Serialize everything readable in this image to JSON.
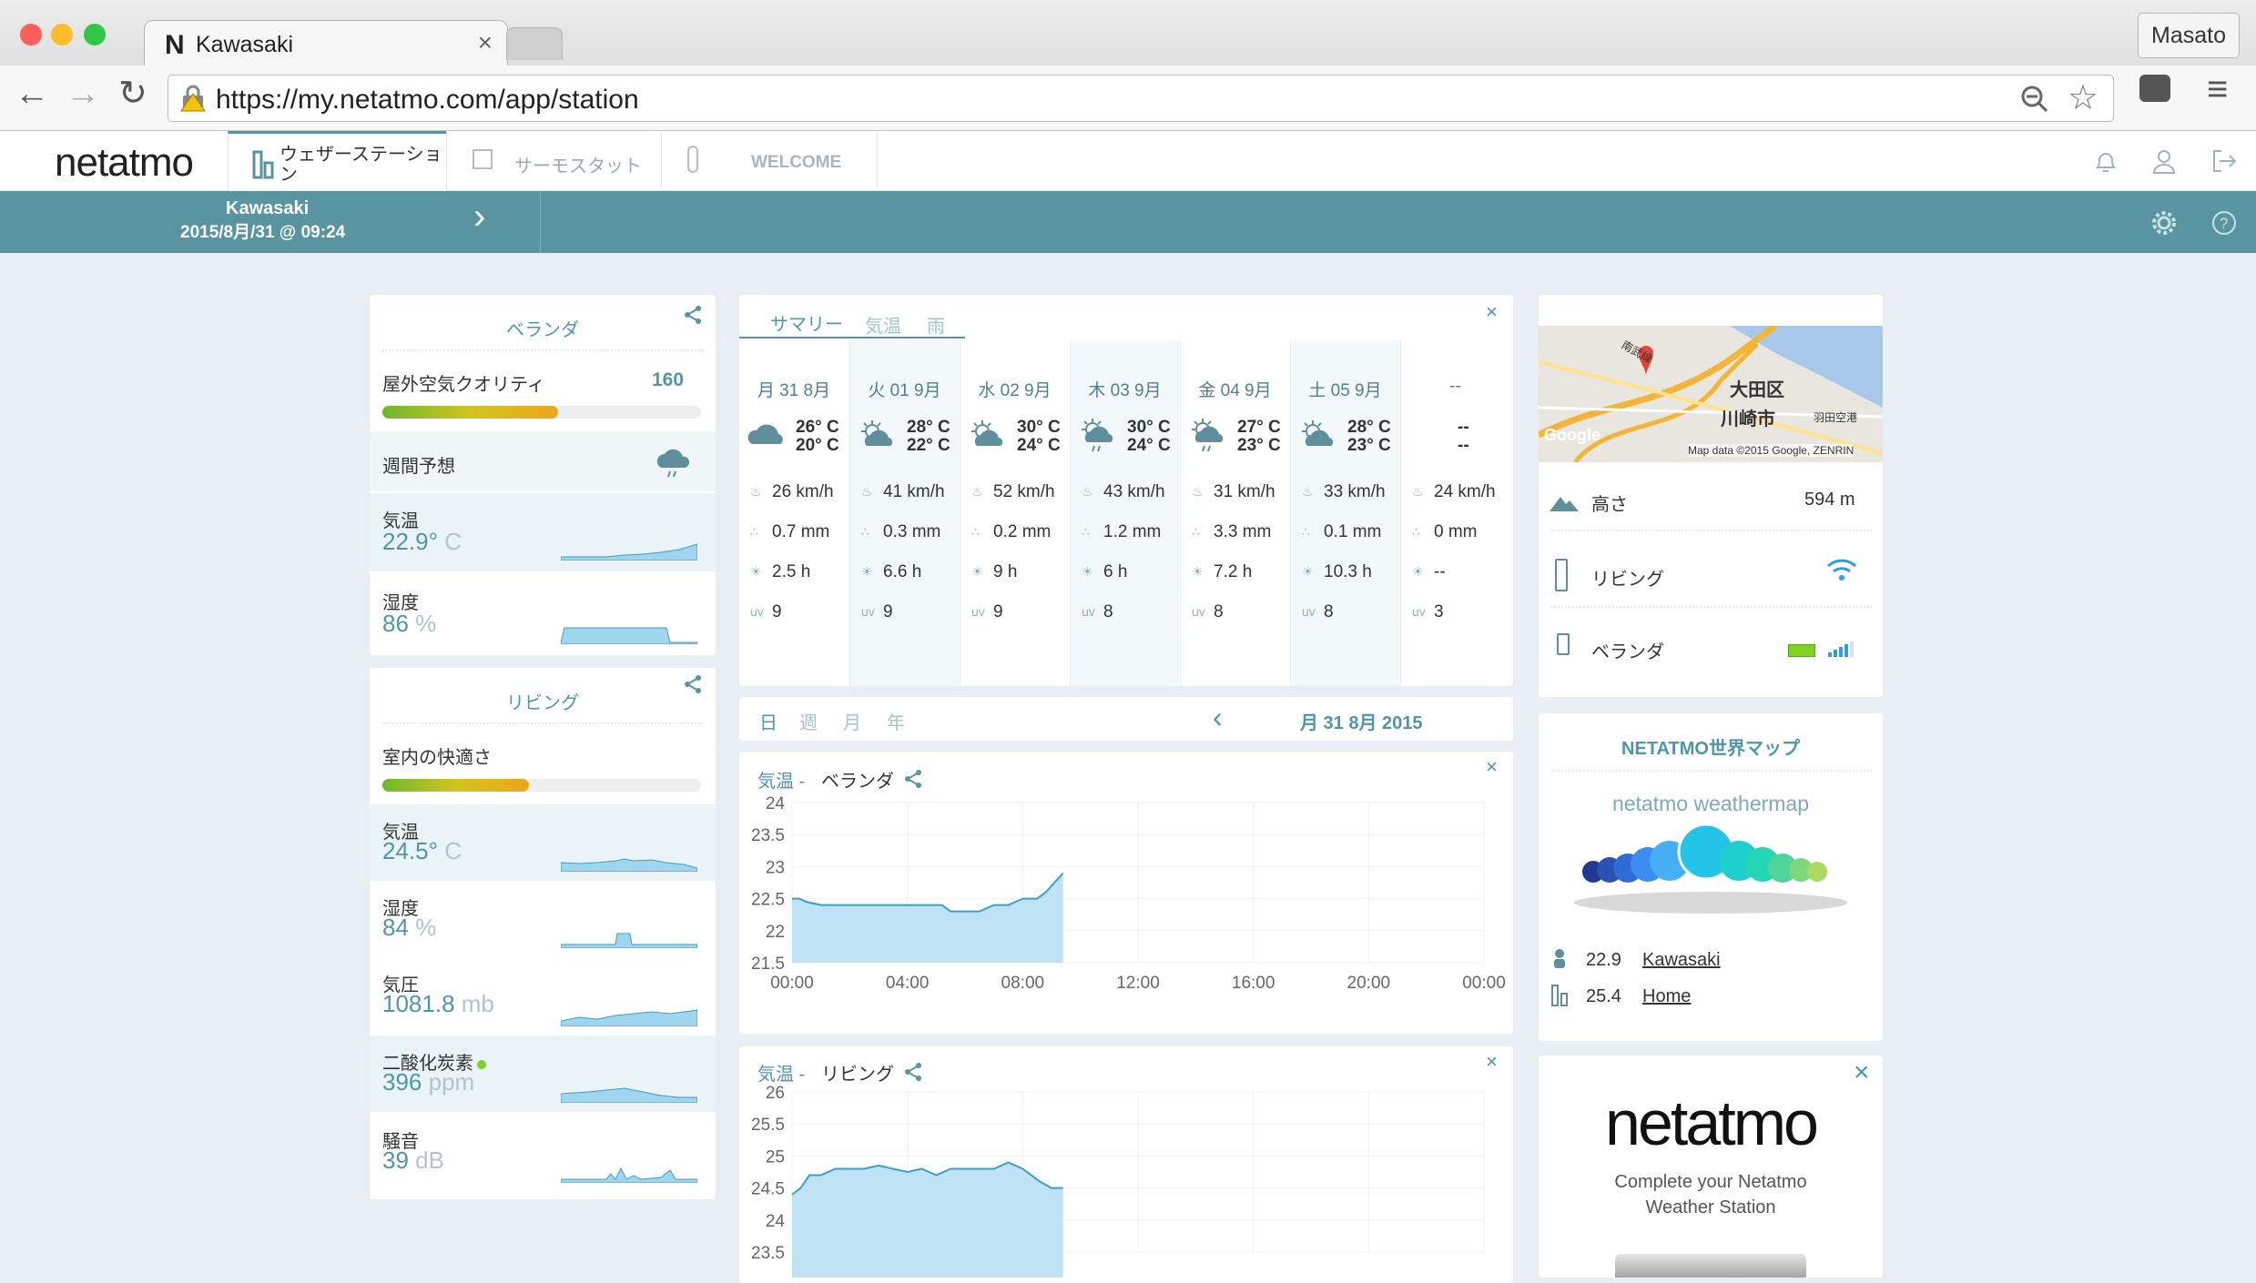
{
  "browser": {
    "tab_title": "Kawasaki",
    "user": "Masato",
    "url": "https://my.netatmo.com/app/station"
  },
  "app": {
    "logo": "netatmo",
    "tabs": [
      {
        "label": "ウェザーステーション"
      },
      {
        "label": "サーモスタット"
      },
      {
        "label": "WELCOME"
      }
    ]
  },
  "strip": {
    "station": "Kawasaki",
    "datetime": "2015/8月/31 @ 09:24"
  },
  "left": {
    "outdoor": {
      "title": "ベランダ",
      "air_quality_label": "屋外空気クオリティ",
      "air_quality_value": "160",
      "air_quality_fraction": 0.55,
      "forecast_label": "週間予想",
      "temp_label": "気温",
      "temp_value": "22.9°",
      "temp_unit": "C",
      "hum_label": "湿度",
      "hum_value": "86",
      "hum_unit": "%"
    },
    "indoor": {
      "title": "リビング",
      "comfort_label": "室内の快適さ",
      "comfort_fraction": 0.46,
      "temp_label": "気温",
      "temp_value": "24.5°",
      "temp_unit": "C",
      "hum_label": "湿度",
      "hum_value": "84",
      "hum_unit": "%",
      "pres_label": "気圧",
      "pres_value": "1081.8",
      "pres_unit": "mb",
      "co2_label": "二酸化炭素",
      "co2_value": "396",
      "co2_unit": "ppm",
      "noise_label": "騒音",
      "noise_value": "39",
      "noise_unit": "dB"
    }
  },
  "forecast": {
    "tabs": [
      "サマリー",
      "気温",
      "雨"
    ],
    "days": [
      {
        "day": "月 31 8月",
        "hi": "26° C",
        "lo": "20° C",
        "wind": "26 km/h",
        "rain": "0.7 mm",
        "sun": "2.5 h",
        "uv": "9",
        "icon": "cloud-icon"
      },
      {
        "day": "火 01 9月",
        "hi": "28° C",
        "lo": "22° C",
        "wind": "41 km/h",
        "rain": "0.3 mm",
        "sun": "6.6 h",
        "uv": "9",
        "icon": "sun-cloud-icon"
      },
      {
        "day": "水 02 9月",
        "hi": "30° C",
        "lo": "24° C",
        "wind": "52 km/h",
        "rain": "0.2 mm",
        "sun": "9 h",
        "uv": "9",
        "icon": "sun-cloud-icon"
      },
      {
        "day": "木 03 9月",
        "hi": "30° C",
        "lo": "24° C",
        "wind": "43 km/h",
        "rain": "1.2 mm",
        "sun": "6 h",
        "uv": "8",
        "icon": "sun-rain-icon"
      },
      {
        "day": "金 04 9月",
        "hi": "27° C",
        "lo": "23° C",
        "wind": "31 km/h",
        "rain": "3.3 mm",
        "sun": "7.2 h",
        "uv": "8",
        "icon": "sun-rain-icon"
      },
      {
        "day": "土 05 9月",
        "hi": "28° C",
        "lo": "23° C",
        "wind": "33 km/h",
        "rain": "0.1 mm",
        "sun": "10.3 h",
        "uv": "8",
        "icon": "sun-cloud-icon"
      },
      {
        "day": "--",
        "hi": "--",
        "lo": "--",
        "wind": "24 km/h",
        "rain": "0 mm",
        "sun": "--",
        "uv": "3",
        "icon": ""
      }
    ]
  },
  "period": {
    "tabs": [
      "日",
      "週",
      "月",
      "年"
    ],
    "date": "月 31 8月 2015"
  },
  "chart_data": [
    {
      "type": "area",
      "title": "気温 -",
      "subtitle": "ベランダ",
      "ylim": [
        21.5,
        24
      ],
      "yticks": [
        "24",
        "23.5",
        "23",
        "22.5",
        "22",
        "21.5"
      ],
      "xticks": [
        "00:00",
        "04:00",
        "08:00",
        "12:00",
        "16:00",
        "20:00",
        "00:00"
      ],
      "x": [
        0,
        0.25,
        0.5,
        1,
        2,
        3,
        4,
        5,
        5.2,
        5.5,
        6,
        6.5,
        7,
        7.5,
        8,
        8.5,
        8.8,
        9,
        9.4
      ],
      "values": [
        22.5,
        22.5,
        22.45,
        22.4,
        22.4,
        22.4,
        22.4,
        22.4,
        22.4,
        22.3,
        22.3,
        22.3,
        22.4,
        22.4,
        22.5,
        22.5,
        22.6,
        22.7,
        22.9
      ]
    },
    {
      "type": "area",
      "title": "気温 -",
      "subtitle": "リビング",
      "ylim": [
        23.5,
        26
      ],
      "yticks": [
        "26",
        "25.5",
        "25",
        "24.5",
        "24",
        "23.5"
      ],
      "xticks": [
        "00:00",
        "04:00",
        "08:00",
        "12:00",
        "16:00",
        "20:00",
        "00:00"
      ],
      "x": [
        0,
        0.3,
        0.6,
        1,
        1.5,
        2,
        2.5,
        3,
        3.5,
        4,
        4.5,
        5,
        5.5,
        6,
        6.5,
        7,
        7.5,
        8,
        8.3,
        8.6,
        9,
        9.4
      ],
      "values": [
        24.4,
        24.5,
        24.7,
        24.7,
        24.8,
        24.8,
        24.8,
        24.85,
        24.8,
        24.75,
        24.8,
        24.7,
        24.8,
        24.8,
        24.8,
        24.8,
        24.9,
        24.8,
        24.7,
        24.6,
        24.5,
        24.5
      ]
    }
  ],
  "right": {
    "map_credit": "Map data ©2015 Google, ZENRIN",
    "map_labels": [
      "大田区",
      "川崎市",
      "南武線",
      "羽田空港"
    ],
    "map_google": "Google",
    "altitude_label": "高さ",
    "altitude_value": "594 m",
    "module1": "リビング",
    "module2": "ベランダ",
    "worldmap_title": "NETATMO世界マップ",
    "worldmap_logo": "netatmo weathermap",
    "worldmap_rows": [
      {
        "value": "22.9",
        "name": "Kawasaki"
      },
      {
        "value": "25.4",
        "name": "Home"
      }
    ],
    "ad_logo": "netatmo",
    "ad_text1": "Complete your Netatmo",
    "ad_text2": "Weather Station"
  },
  "colors": {
    "accent": "#5995a0",
    "teal_text": "#4f96aa",
    "background": "#e8eef4"
  }
}
